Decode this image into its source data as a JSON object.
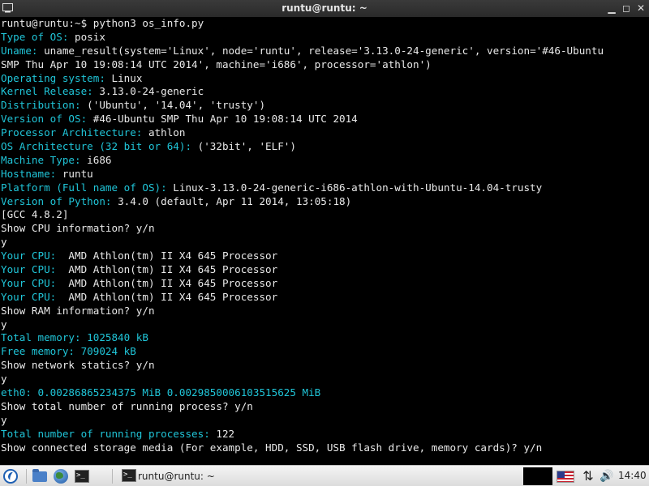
{
  "window": {
    "title": "runtu@runtu: ~",
    "minimize_glyph": "▁",
    "maximize_glyph": "◻",
    "close_glyph": "✕"
  },
  "terminal": {
    "lines": [
      {
        "label": "",
        "text": "runtu@runtu:~$ python3 os_info.py"
      },
      {
        "label": "Type of OS:",
        "text": " posix"
      },
      {
        "label": "Uname:",
        "text": " uname_result(system='Linux', node='runtu', release='3.13.0-24-generic', version='#46-Ubuntu"
      },
      {
        "label": "",
        "text": "SMP Thu Apr 10 19:08:14 UTC 2014', machine='i686', processor='athlon')"
      },
      {
        "label": "Operating system:",
        "text": " Linux"
      },
      {
        "label": "Kernel Release:",
        "text": " 3.13.0-24-generic"
      },
      {
        "label": "Distribution:",
        "text": " ('Ubuntu', '14.04', 'trusty')"
      },
      {
        "label": "Version of OS:",
        "text": " #46-Ubuntu SMP Thu Apr 10 19:08:14 UTC 2014"
      },
      {
        "label": "Processor Architecture:",
        "text": " athlon"
      },
      {
        "label": "OS Architecture (32 bit or 64):",
        "text": " ('32bit', 'ELF')"
      },
      {
        "label": "Machine Type:",
        "text": " i686"
      },
      {
        "label": "Hostname:",
        "text": " runtu"
      },
      {
        "label": "Platform (Full name of OS):",
        "text": " Linux-3.13.0-24-generic-i686-athlon-with-Ubuntu-14.04-trusty"
      },
      {
        "label": "Version of Python:",
        "text": " 3.4.0 (default, Apr 11 2014, 13:05:18)"
      },
      {
        "label": "",
        "text": "[GCC 4.8.2]"
      },
      {
        "label": "",
        "text": "Show CPU information? y/n"
      },
      {
        "label": "",
        "text": "y"
      },
      {
        "label": "Your CPU:",
        "text": "  AMD Athlon(tm) II X4 645 Processor"
      },
      {
        "label": "Your CPU:",
        "text": "  AMD Athlon(tm) II X4 645 Processor"
      },
      {
        "label": "Your CPU:",
        "text": "  AMD Athlon(tm) II X4 645 Processor"
      },
      {
        "label": "Your CPU:",
        "text": "  AMD Athlon(tm) II X4 645 Processor"
      },
      {
        "label": "",
        "text": "Show RAM information? y/n"
      },
      {
        "label": "",
        "text": "y"
      },
      {
        "label": "Total memory: 1025840 kB",
        "text": ""
      },
      {
        "label": "Free memory: 709024 kB",
        "text": ""
      },
      {
        "label": "",
        "text": "Show network statics? y/n"
      },
      {
        "label": "",
        "text": "y"
      },
      {
        "label": "eth0: 0.00286865234375 MiB 0.0029850006103515625 MiB",
        "text": ""
      },
      {
        "label": "",
        "text": "Show total number of running process? y/n"
      },
      {
        "label": "",
        "text": "y"
      },
      {
        "label": "Total number of running processes:",
        "text": " 122"
      },
      {
        "label": "",
        "text": "Show connected storage media (For example, HDD, SSD, USB flash drive, memory cards)? y/n"
      }
    ]
  },
  "taskbar": {
    "task_label": "runtu@runtu: ~",
    "term_glyph": ">_",
    "net_glyph": "⇅",
    "vol_glyph": "🔊",
    "clock": "14:40"
  },
  "colors": {
    "label": "#20c5d8",
    "text": "#e9e9e9",
    "background": "#000000"
  }
}
